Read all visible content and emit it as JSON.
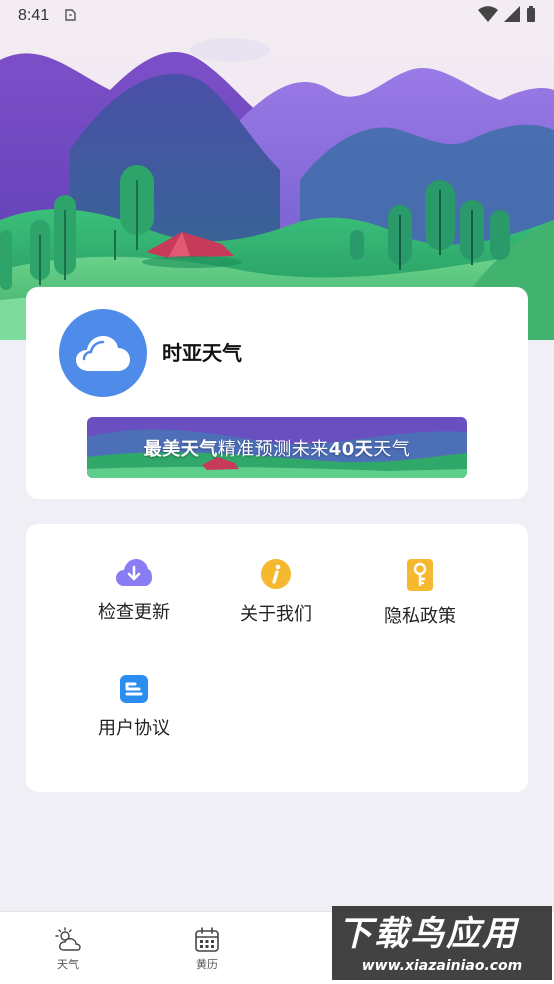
{
  "status_bar": {
    "time": "8:41"
  },
  "profile": {
    "app_name": "时亚天气",
    "banner": {
      "bold_1": "最美天气",
      "light_1": "精准预测未来",
      "bold_2": "40天",
      "light_2": "天气"
    }
  },
  "menu": {
    "items": [
      {
        "label": "检查更新",
        "icon": "cloud-download-icon",
        "color": "#8a7cf2"
      },
      {
        "label": "关于我们",
        "icon": "info-icon",
        "color": "#f5b82e"
      },
      {
        "label": "隐私政策",
        "icon": "key-icon",
        "color": "#f5b82e"
      },
      {
        "label": "用户协议",
        "icon": "document-icon",
        "color": "#2a8ef0"
      }
    ]
  },
  "bottom_nav": {
    "items": [
      {
        "label": "天气",
        "icon": "weather-icon"
      },
      {
        "label": "黄历",
        "icon": "calendar-icon"
      }
    ]
  },
  "watermark": {
    "title": "下载鸟应用",
    "url": "www.xiazainiao.com"
  },
  "colors": {
    "accent": "#4f8be8",
    "background": "#f0eff5"
  }
}
